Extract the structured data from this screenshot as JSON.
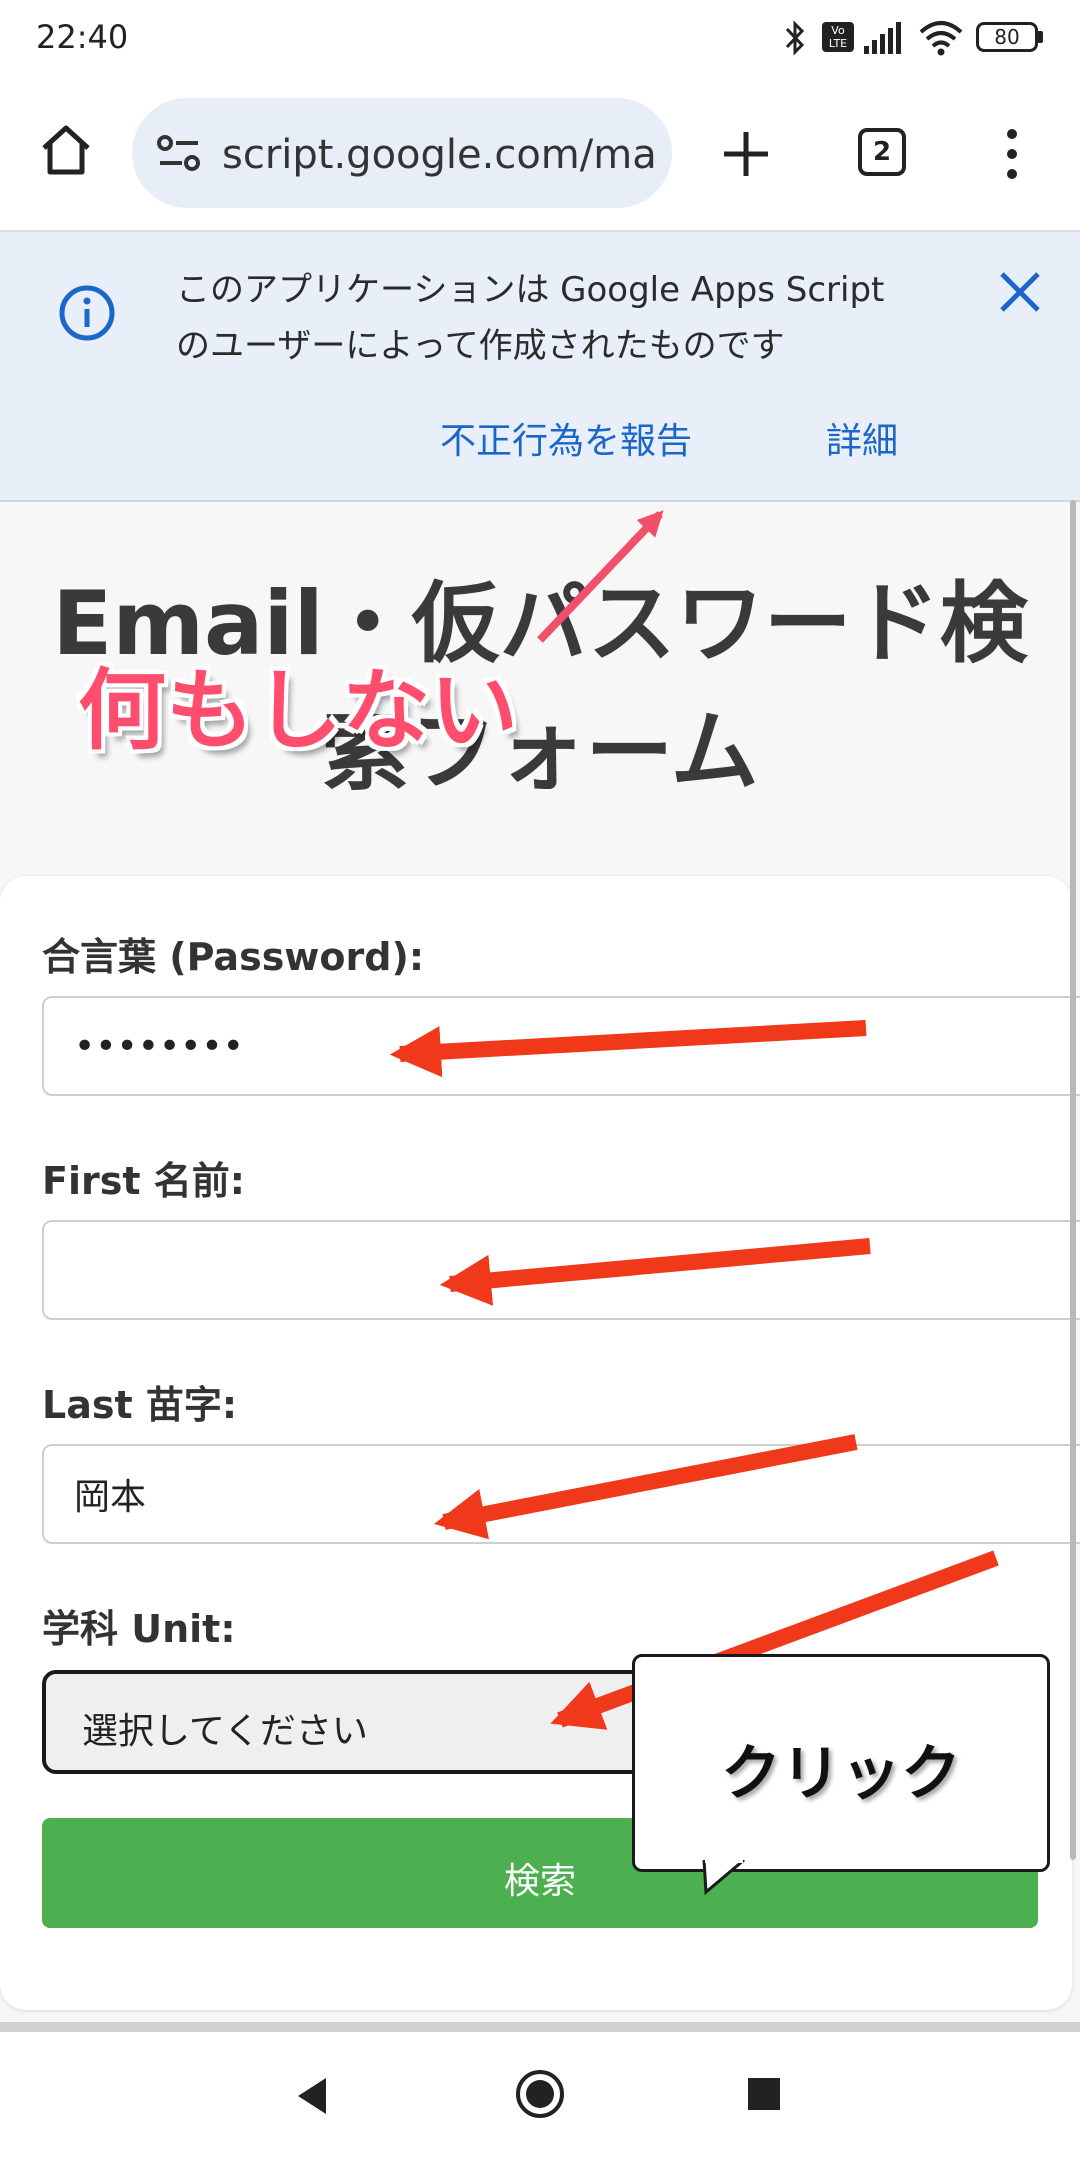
{
  "status_bar": {
    "time": "22:40",
    "volte_label": "Vo LTE",
    "battery": "80"
  },
  "browser": {
    "url": "script.google.com/ma",
    "tab_count": "2"
  },
  "info_banner": {
    "message": "このアプリケーションは Google Apps Script\nのユーザーによって作成されたものです",
    "report_link": "不正行為を報告",
    "details_link": "詳細"
  },
  "page": {
    "title": "Email・仮パスワード検索フォーム"
  },
  "form": {
    "password_label": "合言葉 (Password):",
    "password_value": "••••••••",
    "first_name_label": "First 名前:",
    "first_name_value": "",
    "last_name_label": "Last 苗字:",
    "last_name_value": "岡本",
    "unit_label": "学科 Unit:",
    "unit_selected": "選択してください",
    "search_button": "検索"
  },
  "annotations": {
    "do_nothing": "何もしない",
    "click_callout": "クリック",
    "arrow_color": "#f0391a",
    "pink_arrow_color": "#f0506a"
  }
}
